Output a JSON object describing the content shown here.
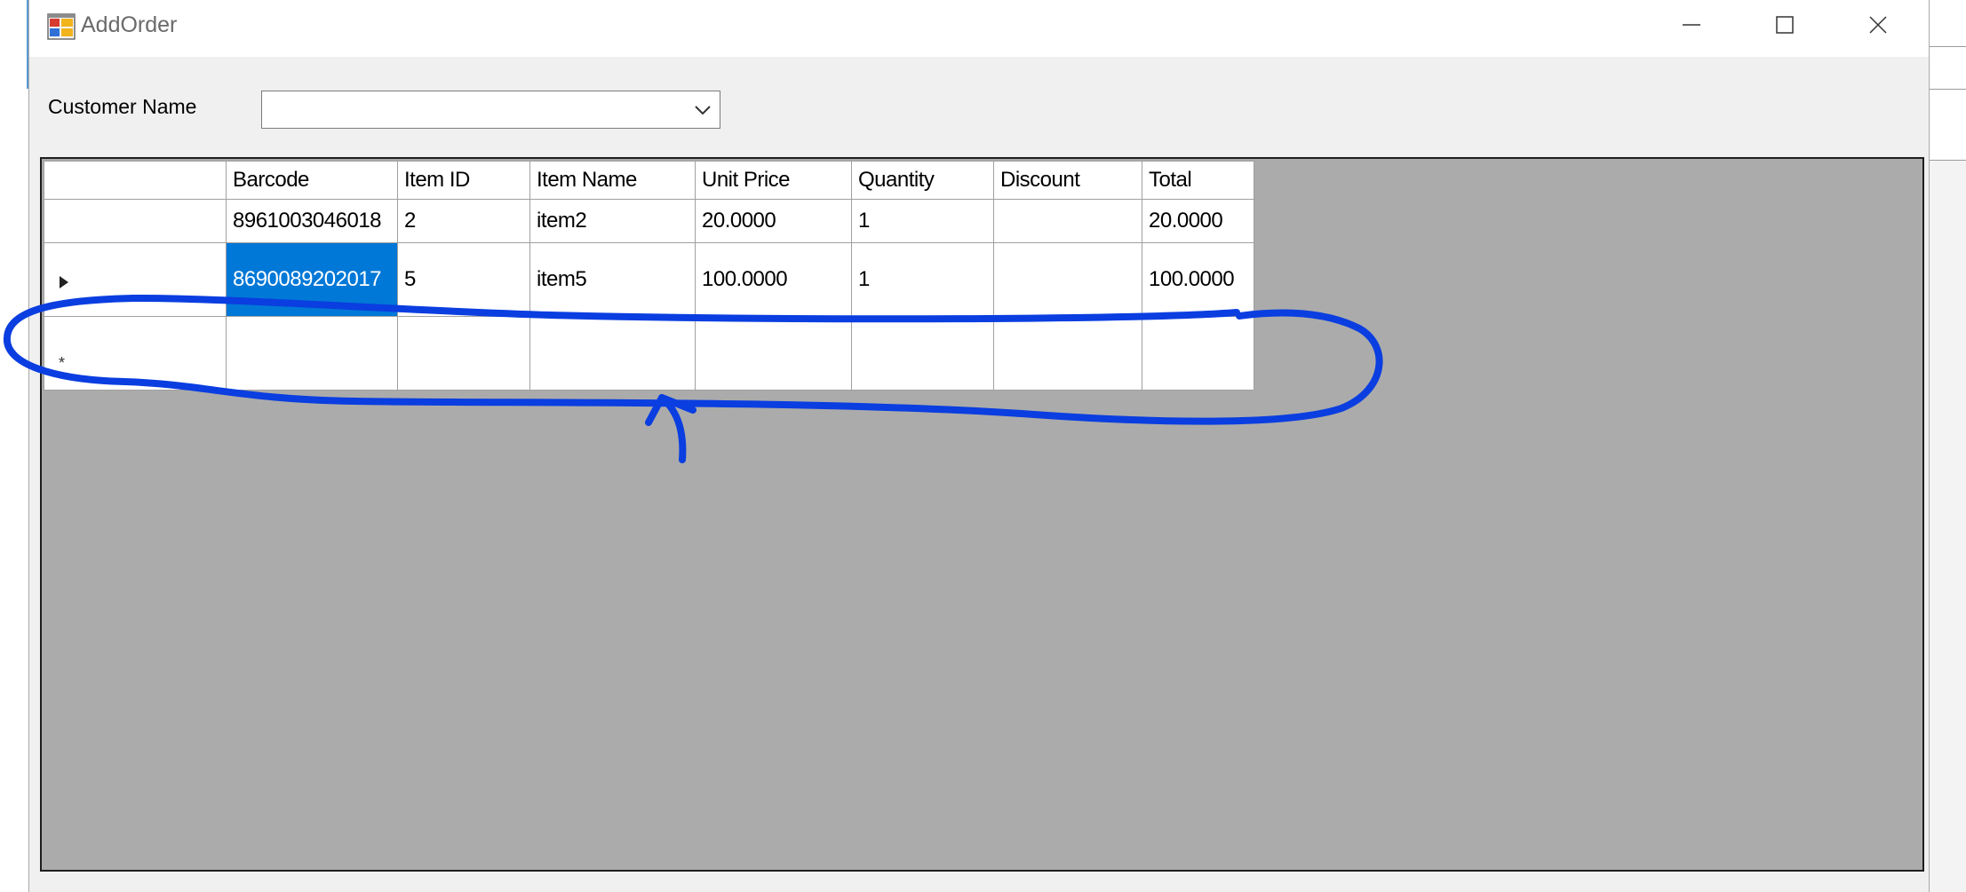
{
  "window": {
    "title": "AddOrder",
    "minimize_label": "",
    "maximize_label": "",
    "close_label": ""
  },
  "form": {
    "customer_label": "Customer Name",
    "customer_value": ""
  },
  "grid": {
    "columns": [
      "Barcode",
      "Item ID",
      "Item Name",
      "Unit Price",
      "Quantity",
      "Discount",
      "Total"
    ],
    "rows": [
      {
        "barcode": "8961003046018",
        "item_id": "2",
        "item_name": "item2",
        "unit_price": "20.0000",
        "quantity": "1",
        "discount": "",
        "total": "20.0000"
      },
      {
        "barcode": "8690089202017",
        "item_id": "5",
        "item_name": "item5",
        "unit_price": "100.0000",
        "quantity": "1",
        "discount": "",
        "total": "100.0000"
      }
    ],
    "new_row_marker": "*",
    "selected_cell": "rows.1.barcode"
  },
  "colors": {
    "selection": "#0078d7",
    "grid_background": "#ababab",
    "annotation": "#0a3ee0"
  },
  "icons": {
    "app": "app-form-icon",
    "minimize": "minimize-icon",
    "maximize": "maximize-icon",
    "close": "close-icon",
    "dropdown": "chevron-down-icon",
    "current_row": "row-pointer-icon"
  },
  "annotation": {
    "type": "hand-drawn circle with arrow around new row"
  }
}
